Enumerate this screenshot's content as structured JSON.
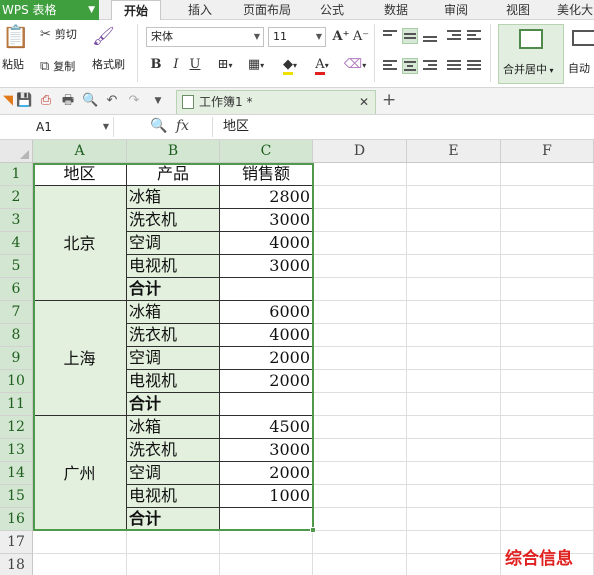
{
  "app": {
    "name": "WPS 表格",
    "accent": "#3f9f3f"
  },
  "menu_tabs": [
    "开始",
    "插入",
    "页面布局",
    "公式",
    "数据",
    "审阅",
    "视图",
    "美化大"
  ],
  "active_tab": "开始",
  "ribbon": {
    "paste_label": "粘贴",
    "cut_label": "剪切",
    "copy_label": "复制",
    "format_painter_label": "格式刷",
    "font_name": "宋体",
    "font_size": "11",
    "merge_center_label": "合并居中",
    "auto_label": "自动"
  },
  "document_tab": {
    "title": "工作簿1 *"
  },
  "formula_bar": {
    "name_box": "A1",
    "fx_label": "fx",
    "content": "地区"
  },
  "sheet": {
    "column_headers": [
      "A",
      "B",
      "C",
      "D",
      "E",
      "F"
    ],
    "row_numbers": [
      "1",
      "2",
      "3",
      "4",
      "5",
      "6",
      "7",
      "8",
      "9",
      "10",
      "11",
      "12",
      "13",
      "14",
      "15",
      "16",
      "17",
      "18"
    ],
    "header_row": {
      "region": "地区",
      "product": "产品",
      "sales": "销售额"
    },
    "groups": [
      {
        "region": "北京",
        "rows": [
          {
            "product": "冰箱",
            "sales": "2800"
          },
          {
            "product": "洗衣机",
            "sales": "3000"
          },
          {
            "product": "空调",
            "sales": "4000"
          },
          {
            "product": "电视机",
            "sales": "3000"
          }
        ],
        "total_label": "合计"
      },
      {
        "region": "上海",
        "rows": [
          {
            "product": "冰箱",
            "sales": "6000"
          },
          {
            "product": "洗衣机",
            "sales": "4000"
          },
          {
            "product": "空调",
            "sales": "2000"
          },
          {
            "product": "电视机",
            "sales": "2000"
          }
        ],
        "total_label": "合计"
      },
      {
        "region": "广州",
        "rows": [
          {
            "product": "冰箱",
            "sales": "4500"
          },
          {
            "product": "洗衣机",
            "sales": "3000"
          },
          {
            "product": "空调",
            "sales": "2000"
          },
          {
            "product": "电视机",
            "sales": "1000"
          }
        ],
        "total_label": "合计"
      }
    ]
  },
  "watermark": "综合信息"
}
